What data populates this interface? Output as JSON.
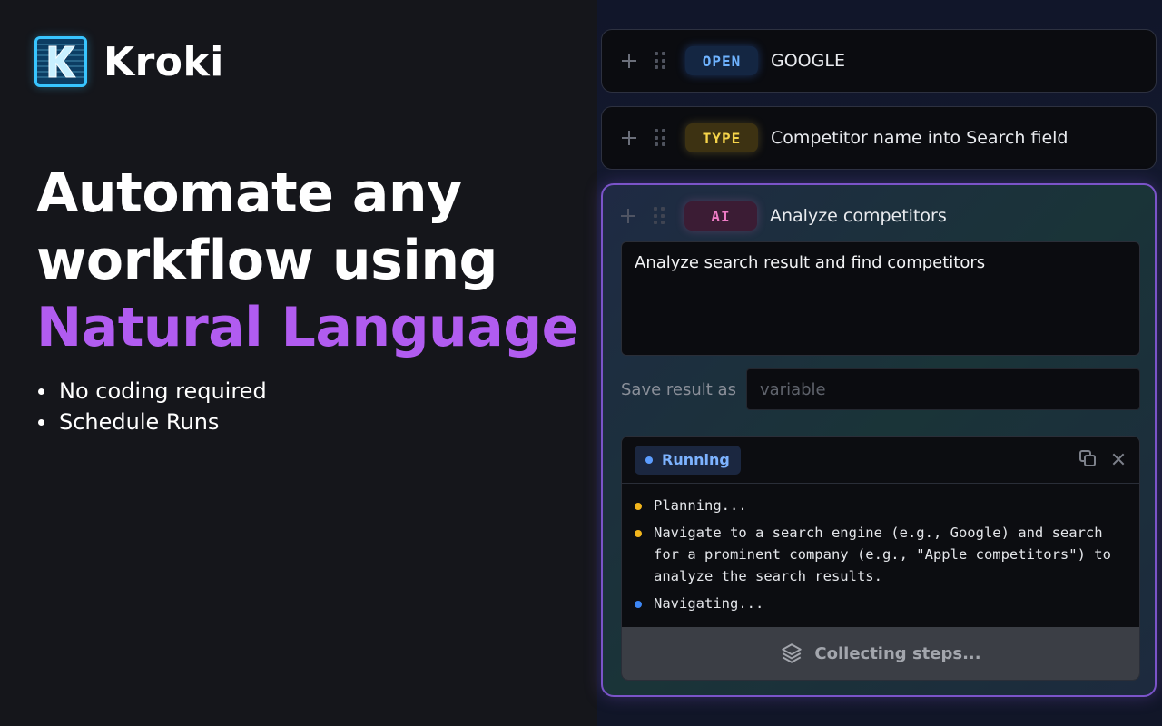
{
  "brand": {
    "name": "Kroki",
    "logo_letter": "K",
    "accent_color": "#38c5ff"
  },
  "hero": {
    "line1": "Automate any",
    "line2": "workflow using",
    "line3": "Natural Language",
    "accent_color": "#b15cf0",
    "bullets": [
      "No coding required",
      "Schedule Runs"
    ]
  },
  "steps": [
    {
      "badge": "OPEN",
      "label": "GOOGLE",
      "color": "#6fb3ff"
    },
    {
      "badge": "TYPE",
      "label": "Competitor name into Search field",
      "color": "#f6d44a"
    },
    {
      "badge": "AI",
      "label": "Analyze competitors",
      "color": "#ef7cc6"
    }
  ],
  "ai_step": {
    "prompt": "Analyze search result and find competitors",
    "save_label": "Save result as",
    "save_placeholder": "variable"
  },
  "run": {
    "status": "Running",
    "log": [
      {
        "text": "Planning...",
        "color": "yellow"
      },
      {
        "text": "Navigate to a search engine (e.g., Google) and search for a prominent company (e.g., \"Apple competitors\") to analyze the search results.",
        "color": "yellow"
      },
      {
        "text": "Navigating...",
        "color": "blue"
      }
    ],
    "footer": "Collecting steps..."
  },
  "icons": [
    "plus-icon",
    "drag-handle-icon",
    "copy-icon",
    "close-icon",
    "layers-icon"
  ]
}
